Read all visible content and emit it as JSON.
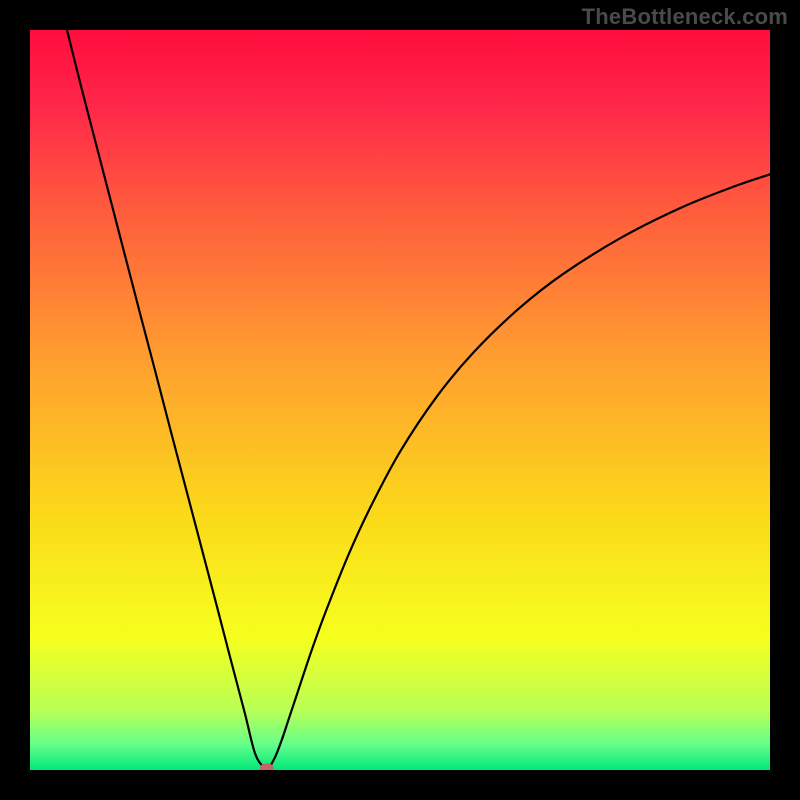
{
  "watermark": "TheBottleneck.com",
  "gradient": {
    "stops": [
      {
        "offset": 0.0,
        "color": "#ff0d3c"
      },
      {
        "offset": 0.1,
        "color": "#ff264a"
      },
      {
        "offset": 0.25,
        "color": "#ff5e3c"
      },
      {
        "offset": 0.45,
        "color": "#ffa030"
      },
      {
        "offset": 0.65,
        "color": "#fbd81a"
      },
      {
        "offset": 0.82,
        "color": "#f6ff1e"
      },
      {
        "offset": 0.92,
        "color": "#b8ff56"
      },
      {
        "offset": 0.965,
        "color": "#66ff8a"
      },
      {
        "offset": 1.0,
        "color": "#00e87a"
      }
    ]
  },
  "chart_data": {
    "type": "line",
    "title": "",
    "xlabel": "",
    "ylabel": "",
    "xlim": [
      0,
      100
    ],
    "ylim": [
      0,
      100
    ],
    "series": [
      {
        "name": "bottleneck_curve",
        "x": [
          5.0,
          7.0,
          9.0,
          11.0,
          13.0,
          15.0,
          17.0,
          19.0,
          21.0,
          23.0,
          25.0,
          27.0,
          29.0,
          30.5,
          32.0,
          33.0,
          34.0,
          35.0,
          36.0,
          38.0,
          40.0,
          43.0,
          46.0,
          50.0,
          55.0,
          60.0,
          66.0,
          72.0,
          80.0,
          88.0,
          95.0,
          100.0
        ],
        "y": [
          100.0,
          92.0,
          84.3,
          76.6,
          68.9,
          61.2,
          53.6,
          45.9,
          38.3,
          30.7,
          23.1,
          15.4,
          7.8,
          2.0,
          0.3,
          1.5,
          4.0,
          7.0,
          10.0,
          16.0,
          21.5,
          29.0,
          35.5,
          43.0,
          50.5,
          56.5,
          62.3,
          67.0,
          72.0,
          76.0,
          78.8,
          80.5
        ]
      }
    ],
    "marker": {
      "x": 32.0,
      "y": 0.3,
      "shape": "ellipse"
    }
  }
}
